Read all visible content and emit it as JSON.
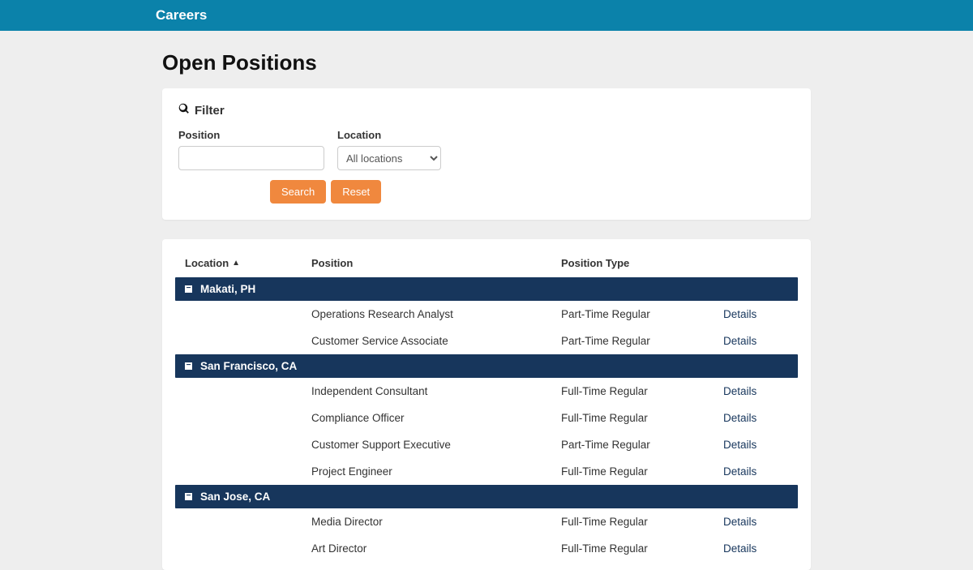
{
  "header": {
    "brand": "Careers"
  },
  "page": {
    "title": "Open Positions"
  },
  "filter": {
    "heading": "Filter",
    "position_label": "Position",
    "position_value": "",
    "location_label": "Location",
    "location_selected": "All locations",
    "search_label": "Search",
    "reset_label": "Reset"
  },
  "table": {
    "columns": {
      "location": "Location",
      "position": "Position",
      "type": "Position Type"
    },
    "action_label": "Details",
    "groups": [
      {
        "name": "Makati, PH",
        "rows": [
          {
            "position": "Operations Research Analyst",
            "type": "Part-Time Regular"
          },
          {
            "position": "Customer Service Associate",
            "type": "Part-Time Regular"
          }
        ]
      },
      {
        "name": "San Francisco, CA",
        "rows": [
          {
            "position": "Independent Consultant",
            "type": "Full-Time Regular"
          },
          {
            "position": "Compliance Officer",
            "type": "Full-Time Regular"
          },
          {
            "position": "Customer Support Executive",
            "type": "Part-Time Regular"
          },
          {
            "position": "Project Engineer",
            "type": "Full-Time Regular"
          }
        ]
      },
      {
        "name": "San Jose, CA",
        "rows": [
          {
            "position": "Media Director",
            "type": "Full-Time Regular"
          },
          {
            "position": "Art Director",
            "type": "Full-Time Regular"
          }
        ]
      }
    ]
  }
}
